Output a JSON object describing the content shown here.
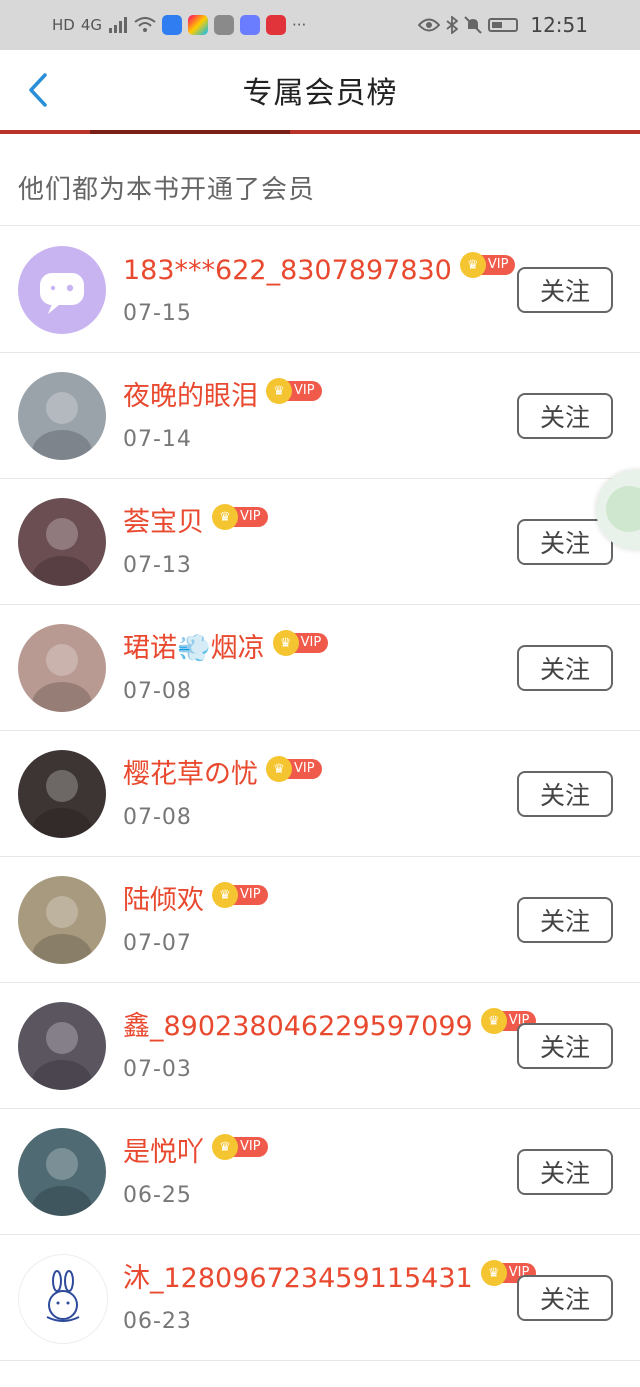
{
  "status_bar": {
    "left_glyphs": [
      "HD",
      "4G",
      "signal-icon",
      "wifi-icon"
    ],
    "time": "12:51"
  },
  "header": {
    "title": "专属会员榜",
    "back_icon": "chevron-left-icon",
    "accent": "#2a8fd8"
  },
  "subtitle": "他们都为本书开通了会员",
  "vip_badge_label": "VIP",
  "follow_label": "关注",
  "members": [
    {
      "name": "183***622_8307897830",
      "date": "07-15",
      "avatar_color": "#c9b4f2"
    },
    {
      "name": "夜晚的眼泪",
      "date": "07-14",
      "avatar_color": "#9aa2aa"
    },
    {
      "name": "荟宝贝",
      "date": "07-13",
      "avatar_color": "#6b4e52"
    },
    {
      "name": "珺诺💨烟凉",
      "date": "07-08",
      "avatar_color": "#b89a92"
    },
    {
      "name": "樱花草の忧",
      "date": "07-08",
      "avatar_color": "#3d3533"
    },
    {
      "name": "陆倾欢",
      "date": "07-07",
      "avatar_color": "#a89a7e"
    },
    {
      "name": "鑫_890238046229597099",
      "date": "07-03",
      "avatar_color": "#5b5560"
    },
    {
      "name": "是悦吖",
      "date": "06-25",
      "avatar_color": "#4f6a73"
    },
    {
      "name": "沐_128096723459115431",
      "date": "06-23",
      "avatar_color": "#ffffff"
    }
  ],
  "colors": {
    "name_red": "#e8492f",
    "vip_red": "#ef5a4b",
    "crown_gold": "#f5c531"
  }
}
